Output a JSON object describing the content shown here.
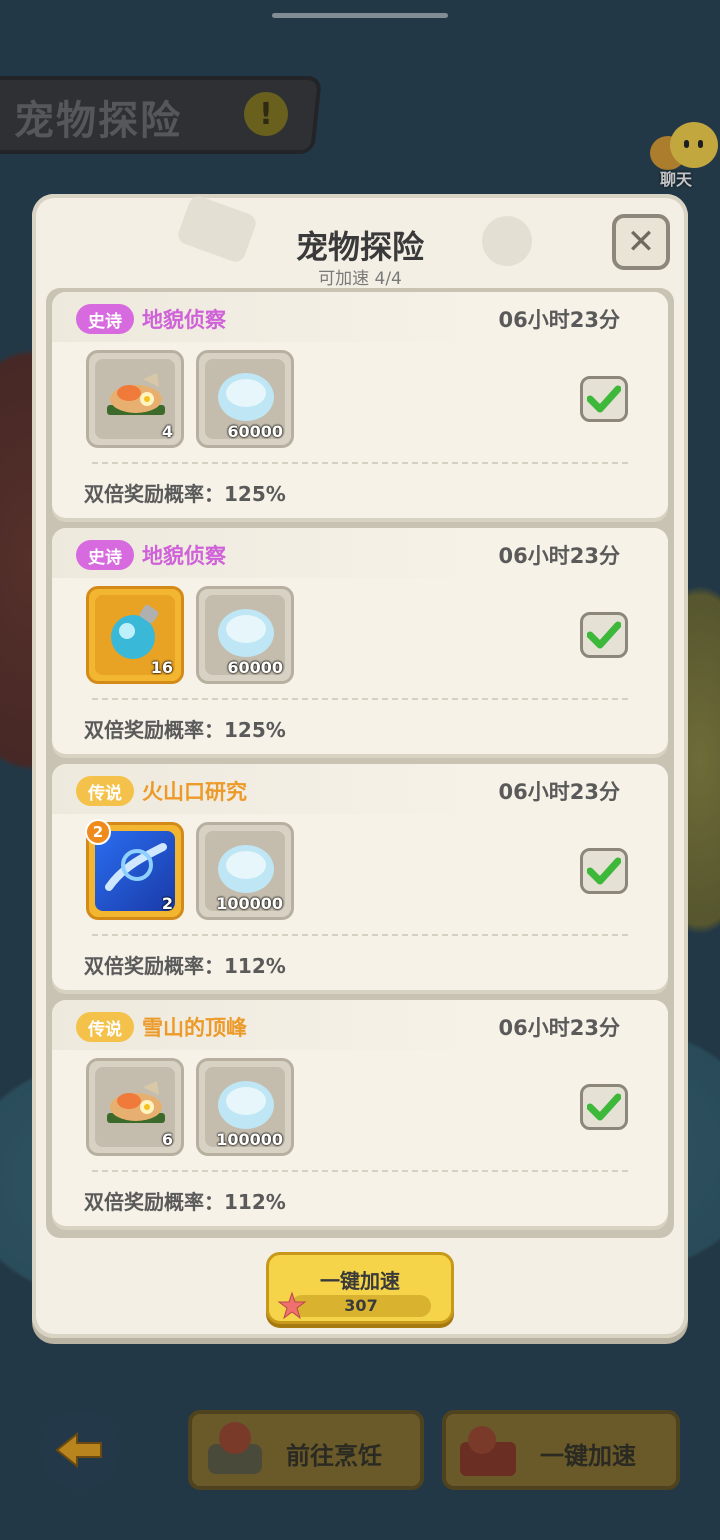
{
  "background": {
    "title": "宠物探险",
    "chat_label": "聊天"
  },
  "modal": {
    "title": "宠物探险",
    "subtitle": "可加速 4/4",
    "close_icon": "close-icon",
    "missions": [
      {
        "rarity": "史诗",
        "rarity_type": "epic",
        "name": "地貌侦察",
        "time": "06小时23分",
        "items": [
          {
            "icon": "food-plate-icon",
            "count": "4",
            "style": "plain"
          },
          {
            "icon": "shell-icon",
            "count": "60000",
            "style": "plain"
          }
        ],
        "checked": true,
        "rate": "双倍奖励概率：125%"
      },
      {
        "rarity": "史诗",
        "rarity_type": "epic",
        "name": "地貌侦察",
        "time": "06小时23分",
        "items": [
          {
            "icon": "potion-bottle-icon",
            "count": "16",
            "style": "gold"
          },
          {
            "icon": "shell-icon",
            "count": "60000",
            "style": "plain"
          }
        ],
        "checked": true,
        "rate": "双倍奖励概率：125%"
      },
      {
        "rarity": "传说",
        "rarity_type": "legend",
        "name": "火山口研究",
        "time": "06小时23分",
        "items": [
          {
            "icon": "skill-card-icon",
            "count": "2",
            "badge": "2",
            "style": "blue"
          },
          {
            "icon": "shell-icon",
            "count": "100000",
            "style": "plain"
          }
        ],
        "checked": true,
        "rate": "双倍奖励概率：112%"
      },
      {
        "rarity": "传说",
        "rarity_type": "legend",
        "name": "雪山的顶峰",
        "time": "06小时23分",
        "items": [
          {
            "icon": "food-plate-icon",
            "count": "6",
            "style": "plain"
          },
          {
            "icon": "shell-icon",
            "count": "100000",
            "style": "plain"
          }
        ],
        "checked": true,
        "rate": "双倍奖励概率：112%"
      }
    ],
    "speed_button": {
      "label": "一键加速",
      "cost": "307",
      "cost_icon": "starfish-icon"
    }
  },
  "bottom_bar": {
    "back_icon": "back-arrow-icon",
    "cook_label": "前往烹饪",
    "speed_label": "一键加速"
  },
  "colors": {
    "epic": "#d86adf",
    "legend": "#f4c24a",
    "check": "#3db83a"
  }
}
